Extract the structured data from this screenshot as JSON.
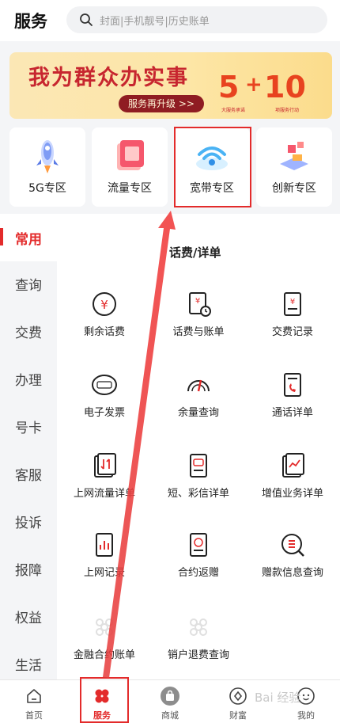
{
  "header": {
    "title": "服务",
    "search_placeholder": "封面|手机靓号|历史账单"
  },
  "banner": {
    "title": "我为群众办实事",
    "button": "服务再升级 >>",
    "num_five": "5",
    "plus": "+",
    "num_ten": "10",
    "caption_five": "大服务承诺",
    "caption_ten": "项服务行动"
  },
  "zones": [
    {
      "label": "5G专区",
      "icon": "rocket-icon"
    },
    {
      "label": "流量专区",
      "icon": "data-card-icon"
    },
    {
      "label": "宽带专区",
      "icon": "wifi-icon"
    },
    {
      "label": "创新专区",
      "icon": "innovation-blocks-icon"
    }
  ],
  "sidebar": {
    "items": [
      {
        "label": "常用",
        "active": true
      },
      {
        "label": "查询",
        "active": false
      },
      {
        "label": "交费",
        "active": false
      },
      {
        "label": "办理",
        "active": false
      },
      {
        "label": "号卡",
        "active": false
      },
      {
        "label": "客服",
        "active": false
      },
      {
        "label": "投诉",
        "active": false
      },
      {
        "label": "报障",
        "active": false
      },
      {
        "label": "权益",
        "active": false
      },
      {
        "label": "生活",
        "active": false
      }
    ]
  },
  "section": {
    "title": "话费/详单",
    "items": [
      {
        "label": "剩余话费",
        "icon": "yuan-coin-icon"
      },
      {
        "label": "话费与账单",
        "icon": "bill-clock-icon"
      },
      {
        "label": "交费记录",
        "icon": "receipt-yuan-icon"
      },
      {
        "label": "电子发票",
        "icon": "invoice-badge-icon"
      },
      {
        "label": "余量查询",
        "icon": "gauge-icon"
      },
      {
        "label": "通话详单",
        "icon": "call-list-icon"
      },
      {
        "label": "上网流量详单",
        "icon": "data-transfer-list-icon"
      },
      {
        "label": "短、彩信详单",
        "icon": "message-list-icon"
      },
      {
        "label": "增值业务详单",
        "icon": "trend-list-icon"
      },
      {
        "label": "上网记录",
        "icon": "bar-chart-list-icon"
      },
      {
        "label": "合约返赠",
        "icon": "contract-gift-icon"
      },
      {
        "label": "赠款信息查询",
        "icon": "search-doc-icon"
      },
      {
        "label": "金融合约账单",
        "icon": "unicom-knot-icon"
      },
      {
        "label": "销户退费查询",
        "icon": "unicom-knot-icon"
      }
    ]
  },
  "nav": {
    "items": [
      {
        "label": "首页",
        "icon": "home-icon",
        "active": false
      },
      {
        "label": "服务",
        "icon": "service-icon",
        "active": true
      },
      {
        "label": "商城",
        "icon": "shopping-bag-icon",
        "active": false
      },
      {
        "label": "财富",
        "icon": "wealth-icon",
        "active": false
      },
      {
        "label": "我的",
        "icon": "profile-icon",
        "active": false
      }
    ]
  },
  "watermark": "Bai 经验",
  "colors": {
    "accent": "#e32b2b",
    "banner_red": "#c7262f",
    "banner_bg": "#fde6a6"
  }
}
